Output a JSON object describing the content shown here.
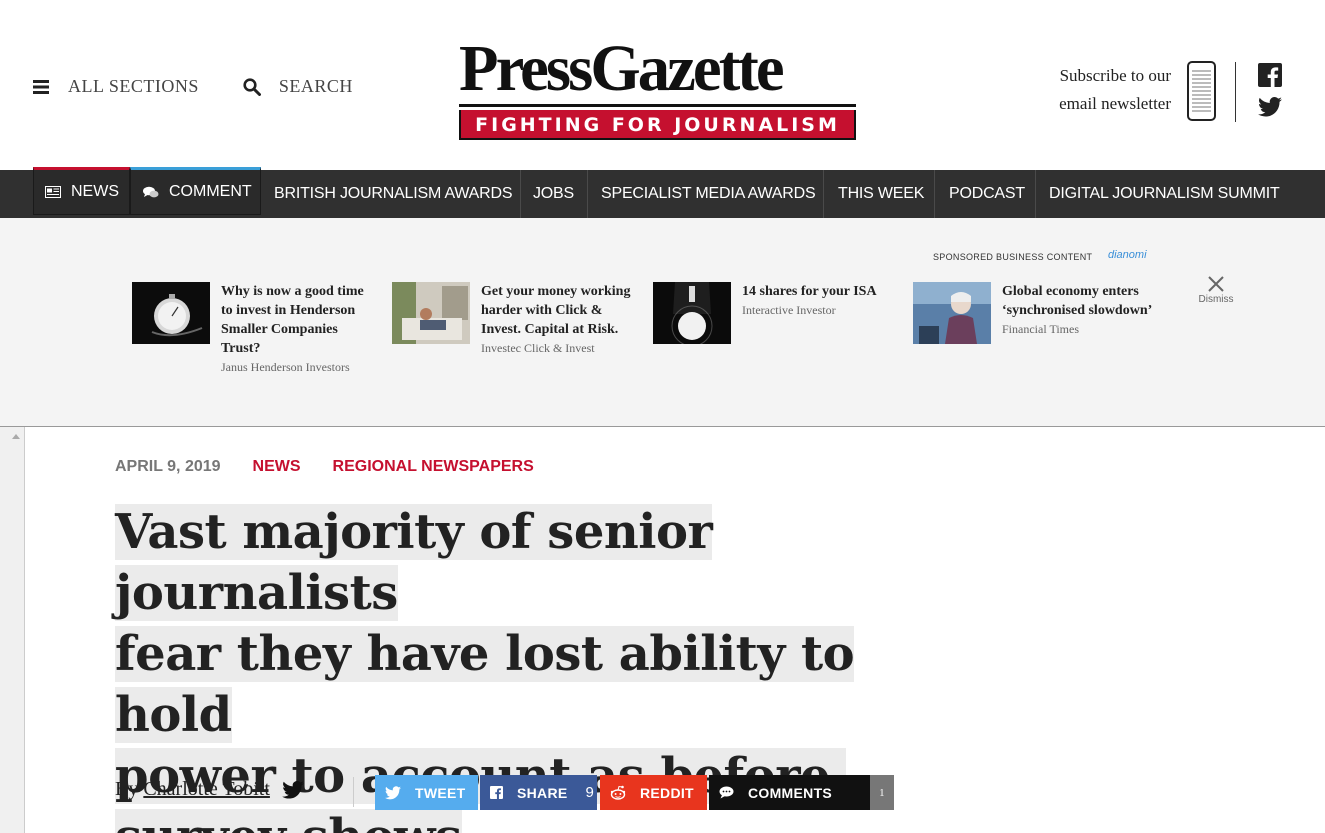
{
  "header": {
    "all_sections": "ALL SECTIONS",
    "search": "SEARCH",
    "logo_title": "PressGazette",
    "logo_tagline": "FIGHTING FOR JOURNALISM",
    "subscribe_line1": "Subscribe to our",
    "subscribe_line2": "email newsletter"
  },
  "nav": {
    "news": "NEWS",
    "comment": "COMMENT",
    "links": [
      "BRITISH JOURNALISM AWARDS",
      "JOBS",
      "SPECIALIST MEDIA AWARDS",
      "THIS WEEK",
      "PODCAST",
      "DIGITAL JOURNALISM SUMMIT"
    ]
  },
  "sponsored": {
    "label": "SPONSORED BUSINESS CONTENT",
    "brand": "dianomi",
    "dismiss": "Dismiss",
    "cards": [
      {
        "title": "Why is now a good time to invest in Henderson Smaller Companies Trust?",
        "source": "Janus Henderson Investors"
      },
      {
        "title": "Get your money working harder with Click & Invest. Capital at Risk.",
        "source": "Investec Click & Invest"
      },
      {
        "title": "14 shares for your ISA",
        "source": "Interactive Investor"
      },
      {
        "title": "Global economy enters ‘synchronised slowdown’",
        "source": "Financial Times"
      }
    ]
  },
  "article": {
    "date": "APRIL 9, 2019",
    "category1": "NEWS",
    "category2": "REGIONAL NEWSPAPERS",
    "headline_lines": [
      "Vast majority of senior journalists",
      "fear they have lost ability to hold",
      "power to account as before,",
      "survey shows"
    ],
    "by": "By",
    "author": "Charlotte Tobitt"
  },
  "share": {
    "tweet": "TWEET",
    "share": "SHARE",
    "share_count": "9",
    "reddit": "REDDIT",
    "comments": "COMMENTS",
    "comments_count": "1"
  },
  "colors": {
    "brand_red": "#c5102f",
    "nav_bg": "#303030",
    "twitter": "#55acee",
    "facebook": "#3b5998",
    "reddit": "#e8351e"
  }
}
